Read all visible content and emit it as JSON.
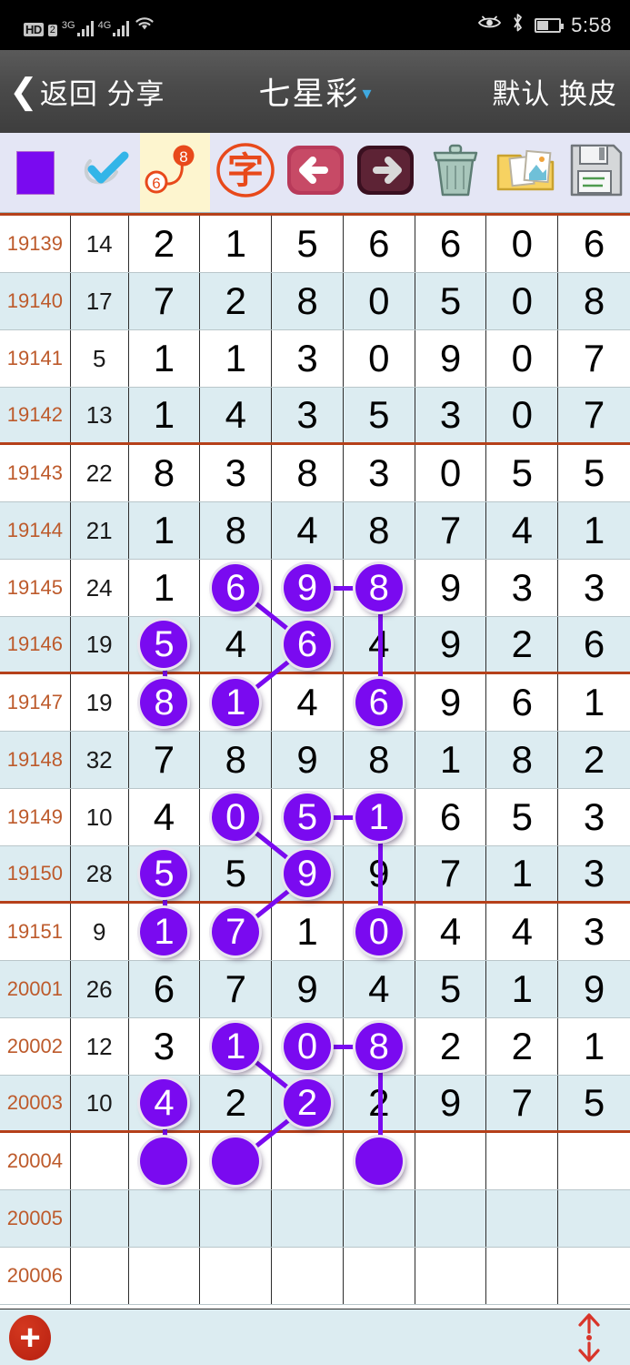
{
  "status_bar": {
    "hd_label": "HD",
    "sim_label": "2",
    "net1_label": "3G",
    "net2_label": "4G",
    "icons": [
      "hd-icon",
      "sim2-icon",
      "signal-3g-icon",
      "signal-4g-icon",
      "wifi-icon",
      "eye-icon",
      "bluetooth-icon",
      "battery-icon"
    ],
    "time": "5:58",
    "battery_percent": 50
  },
  "titlebar": {
    "back_label": "返回 分享",
    "title": "七星彩",
    "caret": "▾",
    "right_label": "默认 换皮"
  },
  "toolbar": {
    "items": [
      {
        "name": "color-swatch-button",
        "label": "",
        "icon": "purple-square-icon",
        "selected": false,
        "color": "#7a0af0"
      },
      {
        "name": "pen-check-button",
        "label": "",
        "icon": "check-pen-icon",
        "selected": false
      },
      {
        "name": "connect-dots-button",
        "label": "",
        "icon": "connect-6-8-icon",
        "selected": true
      },
      {
        "name": "text-mode-button",
        "label": "字",
        "icon": "zi-stamp-icon",
        "selected": false
      },
      {
        "name": "prev-button",
        "label": "",
        "icon": "arrow-left-icon",
        "selected": false
      },
      {
        "name": "next-button",
        "label": "",
        "icon": "arrow-right-icon",
        "selected": false
      },
      {
        "name": "delete-button",
        "label": "",
        "icon": "trash-bin-icon",
        "selected": false
      },
      {
        "name": "gallery-button",
        "label": "",
        "icon": "folder-photos-icon",
        "selected": false
      },
      {
        "name": "save-button",
        "label": "",
        "icon": "floppy-disk-icon",
        "selected": false
      }
    ]
  },
  "table": {
    "columns": [
      "period",
      "sum",
      "d1",
      "d2",
      "d3",
      "d4",
      "d5",
      "d6",
      "d7"
    ],
    "rows": [
      {
        "period": "19139",
        "sum": "14",
        "digits": [
          "2",
          "1",
          "5",
          "6",
          "6",
          "0",
          "6"
        ],
        "marks": []
      },
      {
        "period": "19140",
        "sum": "17",
        "digits": [
          "7",
          "2",
          "8",
          "0",
          "5",
          "0",
          "8"
        ],
        "marks": []
      },
      {
        "period": "19141",
        "sum": "5",
        "digits": [
          "1",
          "1",
          "3",
          "0",
          "9",
          "0",
          "7"
        ],
        "marks": []
      },
      {
        "period": "19142",
        "sum": "13",
        "digits": [
          "1",
          "4",
          "3",
          "5",
          "3",
          "0",
          "7"
        ],
        "marks": []
      },
      {
        "period": "19143",
        "sum": "22",
        "digits": [
          "8",
          "3",
          "8",
          "3",
          "0",
          "5",
          "5"
        ],
        "marks": []
      },
      {
        "period": "19144",
        "sum": "21",
        "digits": [
          "1",
          "8",
          "4",
          "8",
          "7",
          "4",
          "1"
        ],
        "marks": []
      },
      {
        "period": "19145",
        "sum": "24",
        "digits": [
          "1",
          "6",
          "9",
          "8",
          "9",
          "3",
          "3"
        ],
        "marks": [
          1,
          2,
          3
        ]
      },
      {
        "period": "19146",
        "sum": "19",
        "digits": [
          "5",
          "4",
          "6",
          "4",
          "9",
          "2",
          "6"
        ],
        "marks": [
          0,
          2
        ]
      },
      {
        "period": "19147",
        "sum": "19",
        "digits": [
          "8",
          "1",
          "4",
          "6",
          "9",
          "6",
          "1"
        ],
        "marks": [
          0,
          1,
          3
        ]
      },
      {
        "period": "19148",
        "sum": "32",
        "digits": [
          "7",
          "8",
          "9",
          "8",
          "1",
          "8",
          "2"
        ],
        "marks": []
      },
      {
        "period": "19149",
        "sum": "10",
        "digits": [
          "4",
          "0",
          "5",
          "1",
          "6",
          "5",
          "3"
        ],
        "marks": [
          1,
          2,
          3
        ]
      },
      {
        "period": "19150",
        "sum": "28",
        "digits": [
          "5",
          "5",
          "9",
          "9",
          "7",
          "1",
          "3"
        ],
        "marks": [
          0,
          2
        ]
      },
      {
        "period": "19151",
        "sum": "9",
        "digits": [
          "1",
          "7",
          "1",
          "0",
          "4",
          "4",
          "3"
        ],
        "marks": [
          0,
          1,
          3
        ]
      },
      {
        "period": "20001",
        "sum": "26",
        "digits": [
          "6",
          "7",
          "9",
          "4",
          "5",
          "1",
          "9"
        ],
        "marks": []
      },
      {
        "period": "20002",
        "sum": "12",
        "digits": [
          "3",
          "1",
          "0",
          "8",
          "2",
          "2",
          "1"
        ],
        "marks": [
          1,
          2,
          3
        ]
      },
      {
        "period": "20003",
        "sum": "10",
        "digits": [
          "4",
          "2",
          "2",
          "2",
          "9",
          "7",
          "5"
        ],
        "marks": [
          0,
          2
        ]
      },
      {
        "period": "20004",
        "sum": "",
        "digits": [
          "",
          "",
          "",
          "",
          "",
          "",
          ""
        ],
        "marks": [
          0,
          1,
          3
        ],
        "blank_marks": true
      },
      {
        "period": "20005",
        "sum": "",
        "digits": [
          "",
          "",
          "",
          "",
          "",
          "",
          ""
        ],
        "marks": []
      },
      {
        "period": "20006",
        "sum": "",
        "digits": [
          "",
          "",
          "",
          "",
          "",
          "",
          ""
        ],
        "marks": []
      }
    ],
    "separator_after_rows": [
      3,
      7,
      11,
      15
    ],
    "link_color": "#7a0af0",
    "period_color": "#bd5a2b",
    "alt_row_color": "#dcecf1",
    "separator_color": "#b5401a",
    "links": [
      {
        "from": {
          "row": 6,
          "col": 2
        },
        "to": {
          "row": 6,
          "col": 3
        }
      },
      {
        "from": {
          "row": 6,
          "col": 1
        },
        "to": {
          "row": 7,
          "col": 2
        }
      },
      {
        "from": {
          "row": 6,
          "col": 3
        },
        "to": {
          "row": 8,
          "col": 3
        }
      },
      {
        "from": {
          "row": 7,
          "col": 0
        },
        "to": {
          "row": 8,
          "col": 0
        }
      },
      {
        "from": {
          "row": 7,
          "col": 2
        },
        "to": {
          "row": 8,
          "col": 1
        }
      },
      {
        "from": {
          "row": 10,
          "col": 2
        },
        "to": {
          "row": 10,
          "col": 3
        }
      },
      {
        "from": {
          "row": 10,
          "col": 1
        },
        "to": {
          "row": 11,
          "col": 2
        }
      },
      {
        "from": {
          "row": 10,
          "col": 3
        },
        "to": {
          "row": 12,
          "col": 3
        }
      },
      {
        "from": {
          "row": 11,
          "col": 0
        },
        "to": {
          "row": 12,
          "col": 0
        }
      },
      {
        "from": {
          "row": 11,
          "col": 2
        },
        "to": {
          "row": 12,
          "col": 1
        }
      },
      {
        "from": {
          "row": 14,
          "col": 2
        },
        "to": {
          "row": 14,
          "col": 3
        }
      },
      {
        "from": {
          "row": 14,
          "col": 1
        },
        "to": {
          "row": 15,
          "col": 2
        }
      },
      {
        "from": {
          "row": 14,
          "col": 3
        },
        "to": {
          "row": 16,
          "col": 3
        }
      },
      {
        "from": {
          "row": 15,
          "col": 0
        },
        "to": {
          "row": 16,
          "col": 0
        }
      },
      {
        "from": {
          "row": 15,
          "col": 2
        },
        "to": {
          "row": 16,
          "col": 1
        }
      }
    ]
  },
  "bottom_bar": {
    "add_label": "+",
    "add_icon": "plus-circle-icon",
    "scroll_icon": "scroll-up-down-icon"
  }
}
